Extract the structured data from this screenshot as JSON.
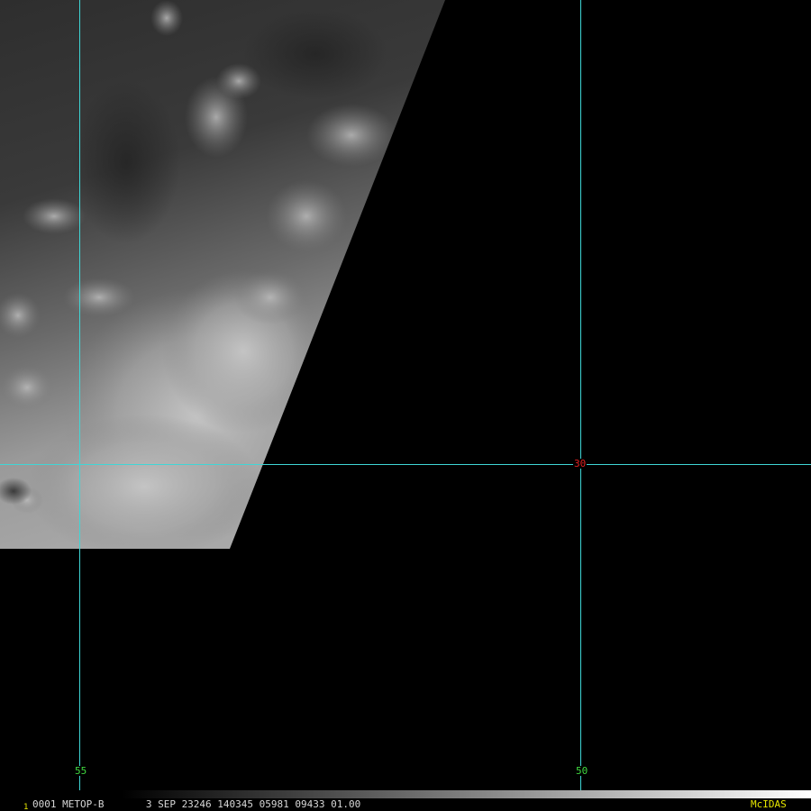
{
  "grid": {
    "color": "#3fd6d6",
    "longitudes": [
      {
        "value": "55",
        "label_color": "#3fd83f"
      },
      {
        "value": "50",
        "label_color": "#3fd83f"
      }
    ],
    "latitudes": [
      {
        "value": "30",
        "label_color": "#e02020"
      }
    ]
  },
  "status_bar": {
    "frame_marker": "1",
    "frame_marker_color": "#e8e800",
    "info_text": "0001 METOP-B       3 SEP 23246 140345 05981 09433 01.00",
    "info_color": "#d8d8d8",
    "brand": "McIDAS",
    "brand_color": "#e8e800"
  }
}
